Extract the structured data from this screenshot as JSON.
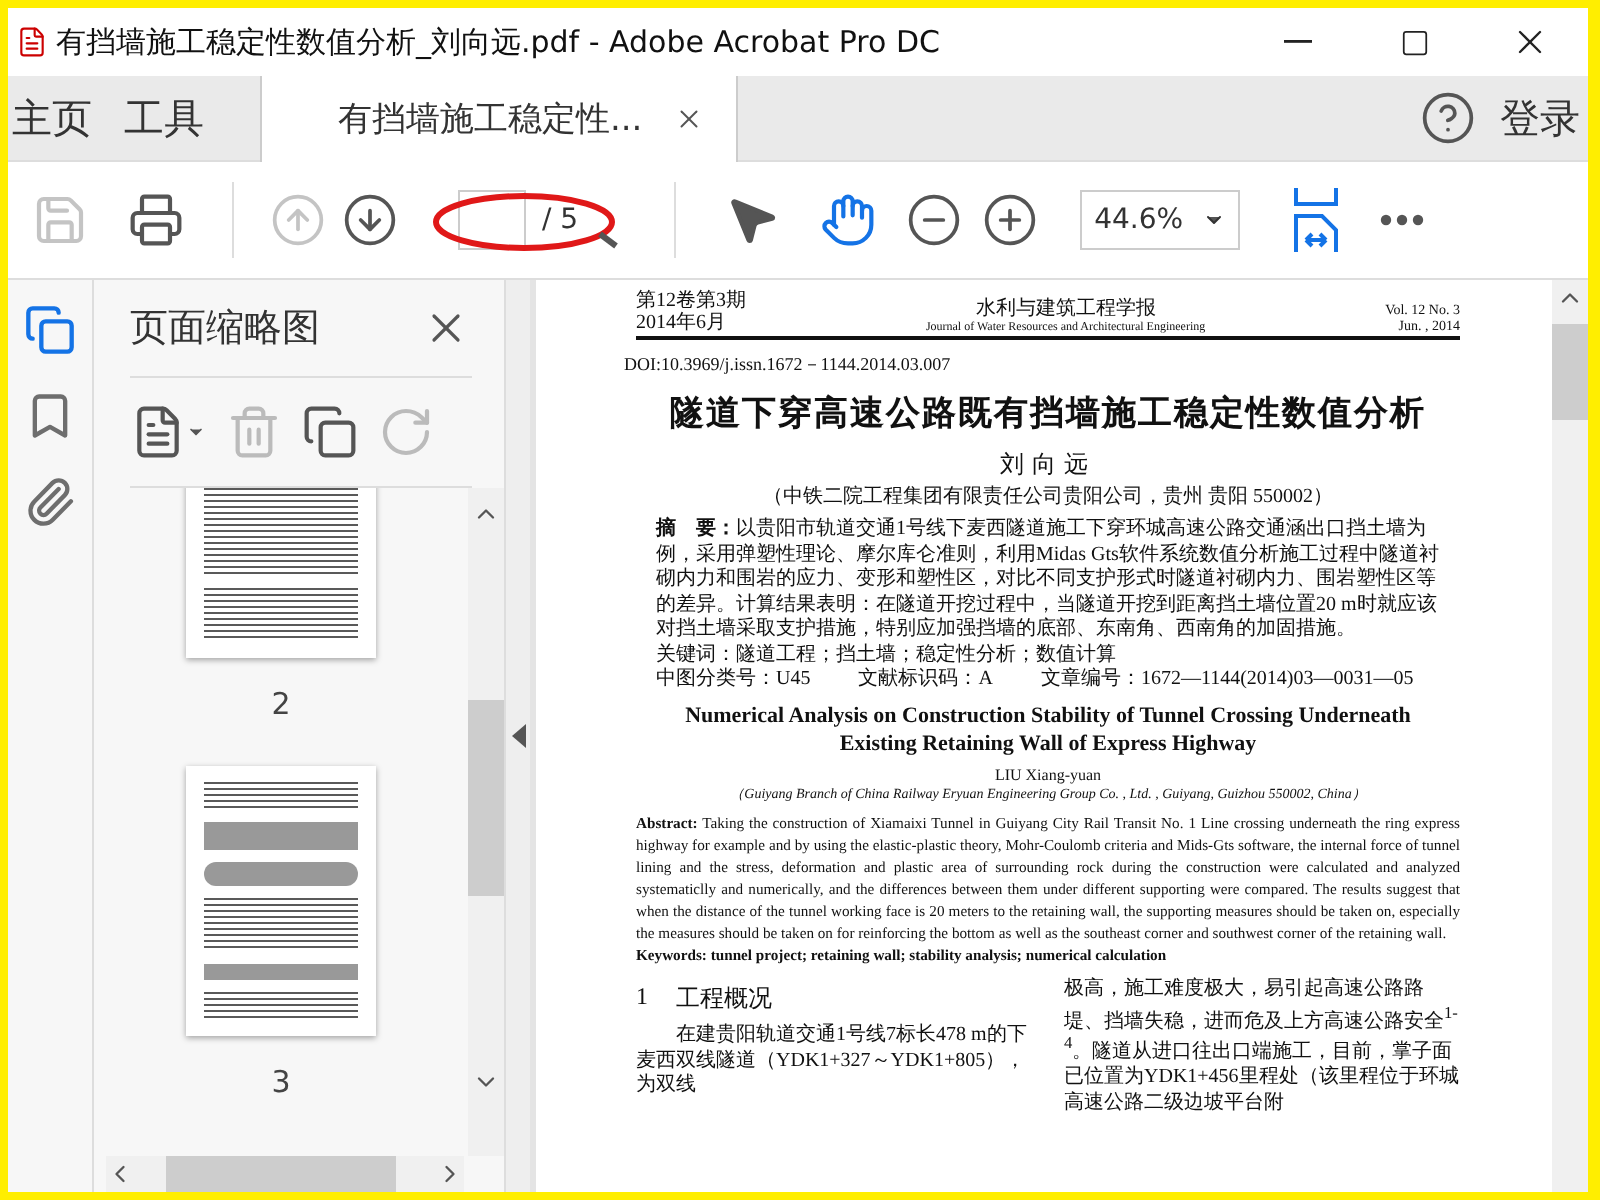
{
  "window": {
    "title": "有挡墙施工稳定性数值分析_刘向远.pdf - Adobe Acrobat Pro DC"
  },
  "tabs": [
    {
      "label": "主页",
      "kind": "nav",
      "selected": false
    },
    {
      "label": "工具",
      "kind": "nav",
      "selected": false
    },
    {
      "label": "有挡墙施工稳定性...",
      "kind": "document",
      "selected": true
    }
  ],
  "account": {
    "label": "登录"
  },
  "toolbar": {
    "file_buttons": [
      {
        "kind": "save",
        "disabled": true
      },
      {
        "kind": "print",
        "disabled": false
      }
    ],
    "page_buttons": [
      {
        "kind": "previous",
        "disabled": true
      },
      {
        "kind": "next",
        "disabled": false
      }
    ],
    "page_field": {
      "total": "/ 5"
    },
    "tools": [
      {
        "kind": "select",
        "selected": false
      },
      {
        "kind": "hand",
        "selected": true
      }
    ],
    "zoom": {
      "value": "44.6%"
    }
  },
  "annotation": {
    "kind": "ellipse"
  },
  "sidebar": {
    "items": [
      {
        "kind": "pages",
        "selected": true
      },
      {
        "kind": "bookmarks",
        "selected": false
      },
      {
        "kind": "attachments",
        "selected": false
      }
    ]
  },
  "thumbnail_panel": {
    "title": "页面缩略图",
    "tools": [
      {
        "kind": "options",
        "disabled": false
      },
      {
        "kind": "delete",
        "disabled": true
      },
      {
        "kind": "insert",
        "disabled": false
      },
      {
        "kind": "rotate",
        "disabled": true
      }
    ],
    "thumbnails": [
      {
        "label": "2",
        "kind": "tables"
      },
      {
        "label": "3",
        "kind": "figures"
      }
    ]
  },
  "document": {
    "header_left": [
      "第12卷第3期",
      "2014年6月"
    ],
    "journal": "水利与建筑工程学报",
    "journal_en": "Journal of Water Resources and Architectural Engineering",
    "header_right": [
      "Vol. 12 No. 3",
      "Jun. , 2014"
    ],
    "doi": "DOI:10.3969/j.issn.1672－1144.2014.03.007",
    "title": "隧道下穿高速公路既有挡墙施工稳定性数值分析",
    "author": "刘向远",
    "affiliation": "（中铁二院工程集团有限责任公司贵阳公司，贵州 贵阳 550002）",
    "abstract": "**摘　要：**以贵阳市轨道交通1号线下麦西隧道施工下穿环城高速公路交通涵出口挡土墙为例，采用弹塑性理论、摩尔库仑准则，利用Midas Gts软件系统数值分析施工过程中隧道衬砌内力和围岩的应力、变形和塑性区，对比不同支护形式时隧道衬砌内力、围岩塑性区等的差异。计算结果表明：在隧道开挖过程中，当隧道开挖到距离挡土墙位置20 m时就应该对挡土墙采取支护措施，特别应加强挡墙的底部、东南角、西南角的加固措施。",
    "keywords": "关键词：隧道工程；挡土墙；稳定性分析；数值计算",
    "classification": [
      "中图分类号：U45",
      "文献标识码：A",
      "文章编号：1672—1144(2014)03—0031—05"
    ],
    "title_en": "Numerical Analysis on Construction Stability of Tunnel Crossing Underneath Existing Retaining Wall of Express Highway",
    "author_en": "LIU Xiang-yuan",
    "affiliation_en": "（Guiyang Branch of China Railway Eryuan Engineering Group Co. , Ltd. , Guiyang, Guizhou 550002, China）",
    "abstract_en": "**Abstract:** Taking the construction of Xiamaixi Tunnel in Guiyang City Rail Transit No. 1 Line crossing underneath the ring express highway for example and by using the elastic-plastic theory, Mohr-Coulomb criteria and Mids-Gts software, the internal force of tunnel lining and the stress, deformation and plastic area of surrounding rock during the construction were calculated and analyzed systematiclly and numerically, and the differences between them under different supporting were compared. The results suggest that when the distance of the tunnel working face is 20 meters to the retaining wall, the supporting measures should be taken on, especially the measures should be taken on for reinforcing the bottom as well as the southeast corner and southwest corner of the retaining wall.",
    "keywords_en": "**Keywords:** **tunnel project; retaining wall; stability analysis; numerical calculation**",
    "section": {
      "number": "1",
      "title": "工程概况"
    },
    "left_column": "在建贵阳轨道交通1号线7标长478 m的下麦西双线隧道（YDK1+327～YDK1+805），为双线",
    "right_column": "极高，施工难度极大，易引起高速公路路堤、挡墙失稳，进而危及上方高速公路安全$^{1-4}$。隧道从进口往出口端施工，目前，掌子面已位置为YDK1+456里程处（该里程位于环城高速公路二级边坡平台附"
  }
}
